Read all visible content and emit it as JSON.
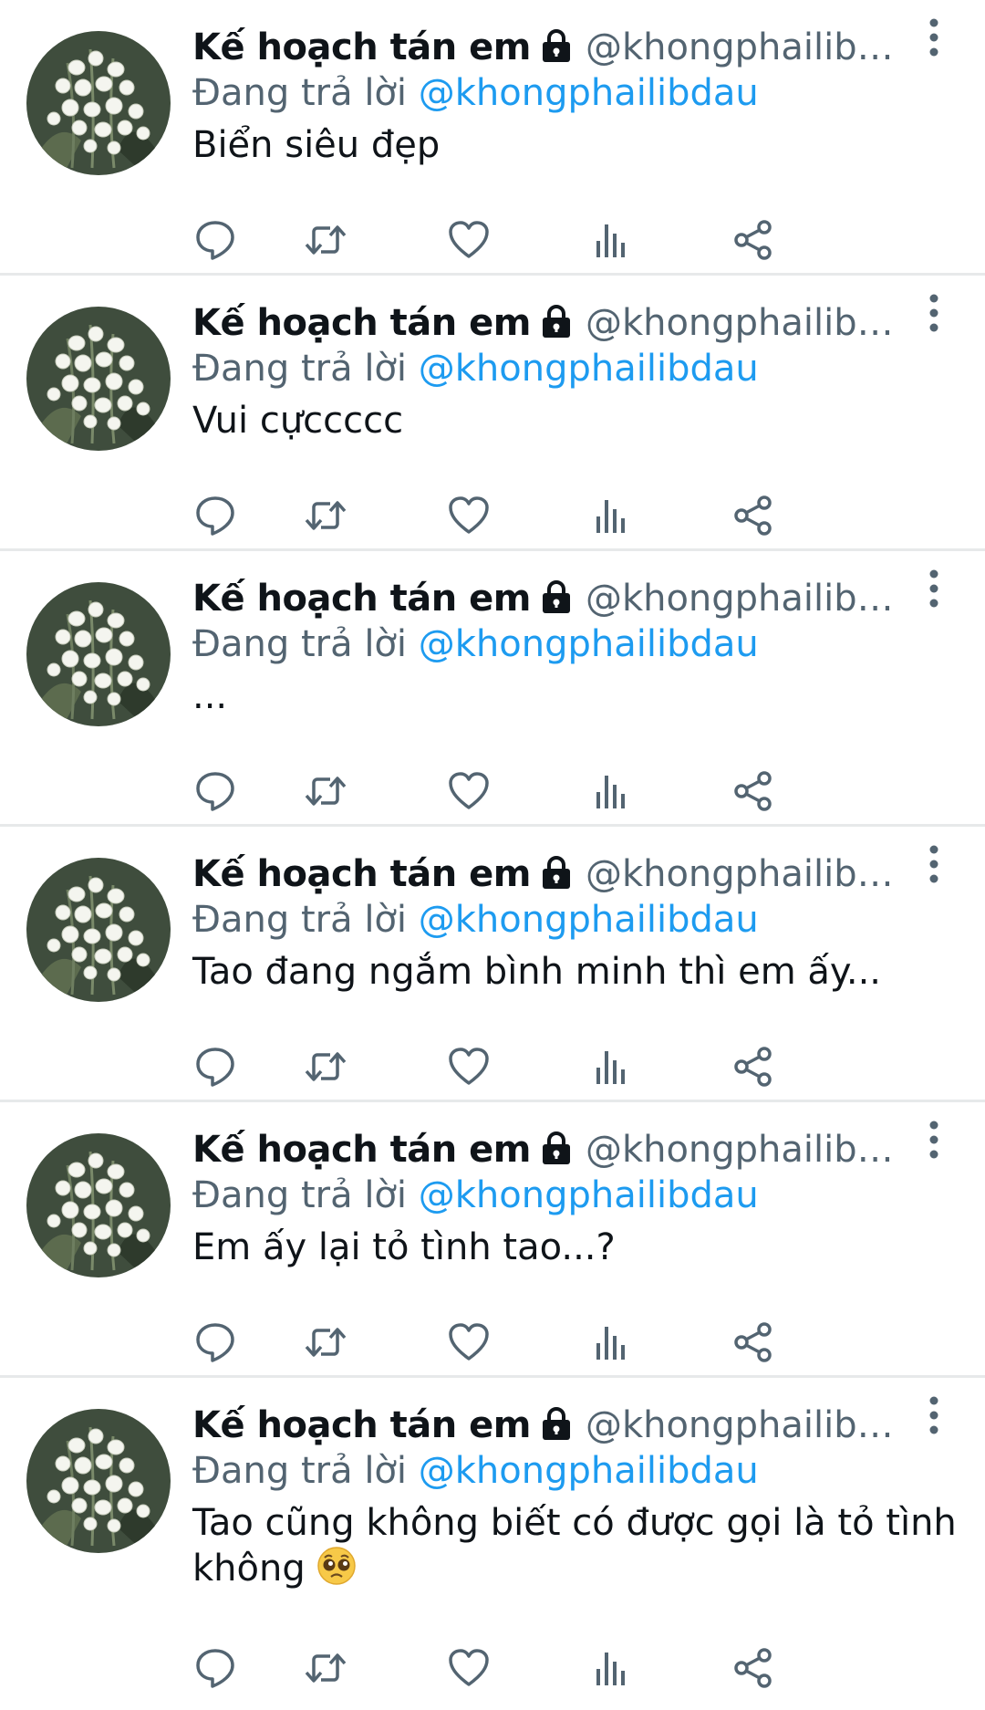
{
  "tweets": [
    {
      "author_name": "Kế hoạch tán em",
      "handle": "@khongphailibd···",
      "replying_prefix": "Đang trả lời",
      "replying_to": "@khongphailibdau",
      "text": "Biển siêu đẹp"
    },
    {
      "author_name": "Kế hoạch tán em",
      "handle": "@khongphailibd···",
      "replying_prefix": "Đang trả lời",
      "replying_to": "@khongphailibdau",
      "text": "Vui cựccccc"
    },
    {
      "author_name": "Kế hoạch tán em",
      "handle": "@khongphailibd···",
      "replying_prefix": "Đang trả lời",
      "replying_to": "@khongphailibdau",
      "text": "..."
    },
    {
      "author_name": "Kế hoạch tán em",
      "handle": "@khongphailibd···",
      "replying_prefix": "Đang trả lời",
      "replying_to": "@khongphailibdau",
      "text": "Tao đang ngắm bình minh thì em ấy..."
    },
    {
      "author_name": "Kế hoạch tán em",
      "handle": "@khongphailibd···",
      "replying_prefix": "Đang trả lời",
      "replying_to": "@khongphailibdau",
      "text": "Em ấy lại tỏ tình tao...?"
    },
    {
      "author_name": "Kế hoạch tán em",
      "handle": "@khongphailibd···",
      "replying_prefix": "Đang trả lời",
      "replying_to": "@khongphailibdau",
      "text": "Tao cũng không biết có được gọi là tỏ tình không",
      "emoji": "pleading-face-emoji"
    }
  ],
  "icons": {
    "lock": "lock-icon",
    "more": "more-vertical-icon",
    "reply": "reply-icon",
    "retweet": "retweet-icon",
    "like": "heart-icon",
    "views": "views-bar-chart-icon",
    "share": "share-icon"
  },
  "colors": {
    "text": "#0f1419",
    "secondary": "#536471",
    "link": "#1d9bf0",
    "divider": "#e7e9ea"
  }
}
